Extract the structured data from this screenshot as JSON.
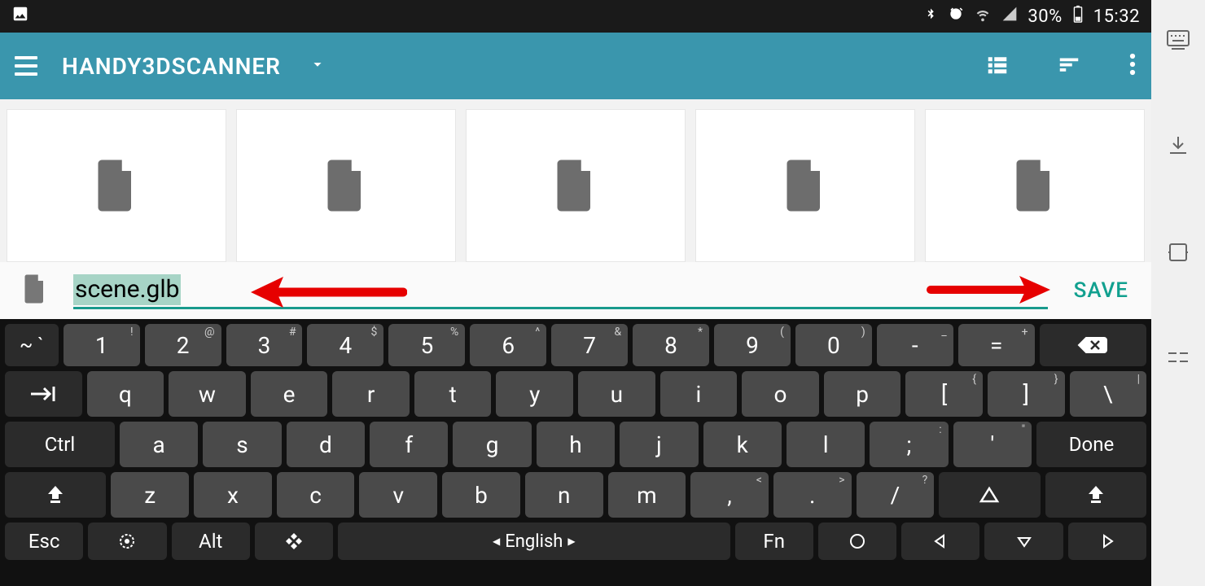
{
  "status": {
    "battery_pct": "30%",
    "time": "15:32"
  },
  "appbar": {
    "title": "HANDY3DSCANNER"
  },
  "files": {
    "count": 5
  },
  "input": {
    "filename": "scene.glb",
    "save_label": "SAVE"
  },
  "keyboard": {
    "row1_first": "~ `",
    "row1": [
      {
        "m": "1",
        "s": "!"
      },
      {
        "m": "2",
        "s": "@"
      },
      {
        "m": "3",
        "s": "#"
      },
      {
        "m": "4",
        "s": "$"
      },
      {
        "m": "5",
        "s": "%"
      },
      {
        "m": "6",
        "s": "^"
      },
      {
        "m": "7",
        "s": "&"
      },
      {
        "m": "8",
        "s": "*"
      },
      {
        "m": "9",
        "s": "("
      },
      {
        "m": "0",
        "s": ")"
      },
      {
        "m": "-",
        "s": "_"
      },
      {
        "m": "=",
        "s": "+"
      }
    ],
    "row2": [
      {
        "m": "q"
      },
      {
        "m": "w"
      },
      {
        "m": "e"
      },
      {
        "m": "r"
      },
      {
        "m": "t"
      },
      {
        "m": "y"
      },
      {
        "m": "u"
      },
      {
        "m": "i"
      },
      {
        "m": "o"
      },
      {
        "m": "p"
      },
      {
        "m": "[",
        "s": "{"
      },
      {
        "m": "]",
        "s": "}"
      },
      {
        "m": "\\",
        "s": "|"
      }
    ],
    "ctrl": "Ctrl",
    "row3": [
      {
        "m": "a"
      },
      {
        "m": "s"
      },
      {
        "m": "d"
      },
      {
        "m": "f"
      },
      {
        "m": "g"
      },
      {
        "m": "h"
      },
      {
        "m": "j"
      },
      {
        "m": "k"
      },
      {
        "m": "l"
      },
      {
        "m": ";",
        "s": ":"
      },
      {
        "m": "'",
        "s": "\""
      }
    ],
    "done": "Done",
    "row4": [
      {
        "m": "z"
      },
      {
        "m": "x"
      },
      {
        "m": "c"
      },
      {
        "m": "v"
      },
      {
        "m": "b"
      },
      {
        "m": "n"
      },
      {
        "m": "m"
      },
      {
        "m": ",",
        "s": "<"
      },
      {
        "m": ".",
        "s": ">"
      },
      {
        "m": "/",
        "s": "?"
      }
    ],
    "esc": "Esc",
    "alt": "Alt",
    "space": "English",
    "fn": "Fn"
  }
}
